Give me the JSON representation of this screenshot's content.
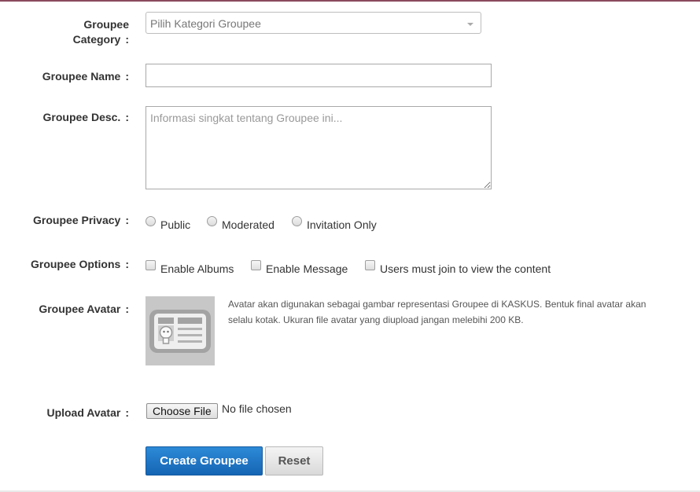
{
  "form": {
    "category": {
      "label_line1": "Groupee",
      "label_line2": "Category",
      "colon": ":",
      "placeholder": "Pilih Kategori Groupee"
    },
    "name": {
      "label": "Groupee Name",
      "colon": ":",
      "value": ""
    },
    "desc": {
      "label": "Groupee Desc.",
      "colon": ":",
      "placeholder": "Informasi singkat tentang Groupee ini..."
    },
    "privacy": {
      "label": "Groupee Privacy",
      "colon": ":",
      "options": [
        "Public",
        "Moderated",
        "Invitation Only"
      ]
    },
    "options": {
      "label": "Groupee Options",
      "colon": ":",
      "items": [
        "Enable Albums",
        "Enable Message",
        "Users must join to view the content"
      ]
    },
    "avatar": {
      "label": "Groupee Avatar",
      "colon": ":",
      "description": "Avatar akan digunakan sebagai gambar representasi Groupee di KASKUS. Bentuk final avatar akan selalu kotak. Ukuran file avatar yang diupload jangan melebihi 200 KB.",
      "icon": "id-card-icon"
    },
    "upload": {
      "label": "Upload Avatar",
      "colon": ":",
      "button": "Choose File",
      "status": "No file chosen"
    },
    "actions": {
      "create": "Create Groupee",
      "reset": "Reset"
    }
  },
  "colors": {
    "primary": "#1e76c8",
    "top_border": "#8a4a5e",
    "avatar_bg": "#c7c7c7"
  }
}
